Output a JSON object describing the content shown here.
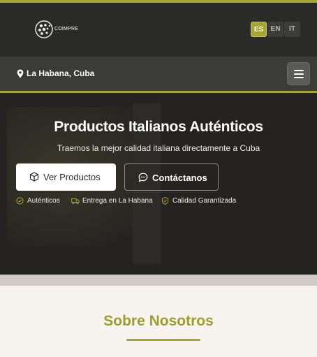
{
  "header": {
    "logo_text": "COIMPRE",
    "languages": [
      {
        "code": "ES",
        "active": true
      },
      {
        "code": "EN",
        "active": false
      },
      {
        "code": "IT",
        "active": false
      }
    ],
    "accent_color": "#a4a62e",
    "background_color": "#2a2a28"
  },
  "location_bar": {
    "location": "La Habana, Cuba",
    "icons": {
      "location": "map-pin-icon",
      "menu": "hamburger-menu-icon"
    }
  },
  "hero": {
    "title": "Productos Italianos Auténticos",
    "subtitle": "Traemos la mejor calidad italiana directamente a Cuba",
    "primary_button": {
      "label": "Ver Productos",
      "icon": "box-icon"
    },
    "secondary_button": {
      "label": "Contáctanos",
      "icon": "chat-bubble-icon"
    },
    "features": [
      {
        "label": "Auténticos",
        "icon": "check-circle-icon"
      },
      {
        "label": "Entrega en La Habana",
        "icon": "truck-icon"
      },
      {
        "label": "Calidad Garantizada",
        "icon": "shield-check-icon"
      }
    ]
  },
  "about": {
    "title": "Sobre Nosotros",
    "title_color": "#9c9d2c"
  }
}
